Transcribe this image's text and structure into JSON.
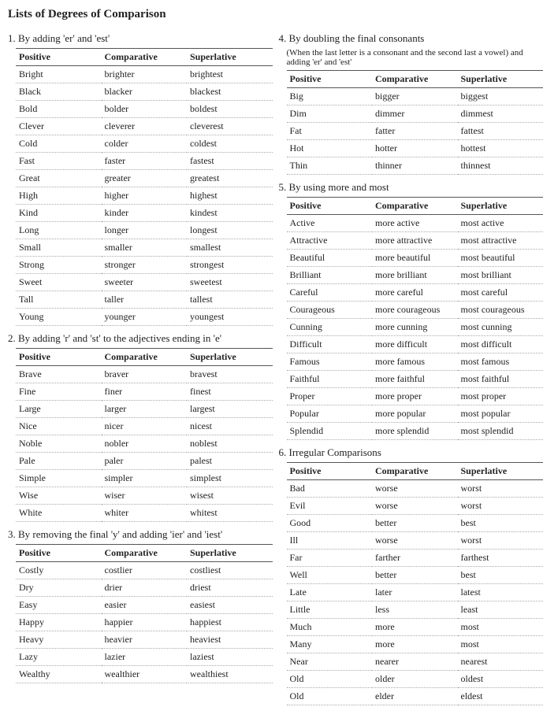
{
  "title": "Lists of Degrees of Comparison",
  "headers": {
    "positive": "Positive",
    "comparative": "Comparative",
    "superlative": "Superlative"
  },
  "sections": [
    {
      "title": "1. By adding 'er' and 'est'",
      "rows": [
        [
          "Bright",
          "brighter",
          "brightest"
        ],
        [
          "Black",
          "blacker",
          "blackest"
        ],
        [
          "Bold",
          "bolder",
          "boldest"
        ],
        [
          "Clever",
          "cleverer",
          "cleverest"
        ],
        [
          "Cold",
          "colder",
          "coldest"
        ],
        [
          "Fast",
          "faster",
          "fastest"
        ],
        [
          "Great",
          "greater",
          "greatest"
        ],
        [
          "High",
          "higher",
          "highest"
        ],
        [
          "Kind",
          "kinder",
          "kindest"
        ],
        [
          "Long",
          "longer",
          "longest"
        ],
        [
          "Small",
          "smaller",
          "smallest"
        ],
        [
          "Strong",
          "stronger",
          "strongest"
        ],
        [
          "Sweet",
          "sweeter",
          "sweetest"
        ],
        [
          "Tall",
          "taller",
          "tallest"
        ],
        [
          "Young",
          "younger",
          "youngest"
        ]
      ]
    },
    {
      "title": "2. By adding 'r' and 'st' to the adjectives ending in 'e'",
      "rows": [
        [
          "Brave",
          "braver",
          "bravest"
        ],
        [
          "Fine",
          "finer",
          "finest"
        ],
        [
          "Large",
          "larger",
          "largest"
        ],
        [
          "Nice",
          "nicer",
          "nicest"
        ],
        [
          "Noble",
          "nobler",
          "noblest"
        ],
        [
          "Pale",
          "paler",
          "palest"
        ],
        [
          "Simple",
          "simpler",
          "simplest"
        ],
        [
          "Wise",
          "wiser",
          "wisest"
        ],
        [
          "White",
          "whiter",
          "whitest"
        ]
      ]
    },
    {
      "title": "3. By removing the final 'y' and adding 'ier' and 'iest'",
      "rows": [
        [
          "Costly",
          "costlier",
          "costliest"
        ],
        [
          "Dry",
          "drier",
          "driest"
        ],
        [
          "Easy",
          "easier",
          "easiest"
        ],
        [
          "Happy",
          "happier",
          "happiest"
        ],
        [
          "Heavy",
          "heavier",
          "heaviest"
        ],
        [
          "Lazy",
          "lazier",
          "laziest"
        ],
        [
          "Wealthy",
          "wealthier",
          "wealthiest"
        ]
      ]
    },
    {
      "title": "4. By doubling the final consonants",
      "subnote": "(When the last letter is a consonant and the second last a vowel) and adding 'er' and 'est'",
      "rows": [
        [
          "Big",
          "bigger",
          "biggest"
        ],
        [
          "Dim",
          "dimmer",
          "dimmest"
        ],
        [
          "Fat",
          "fatter",
          "fattest"
        ],
        [
          "Hot",
          "hotter",
          "hottest"
        ],
        [
          "Thin",
          "thinner",
          "thinnest"
        ]
      ]
    },
    {
      "title": "5. By using more and most",
      "rows": [
        [
          "Active",
          "more active",
          "most active"
        ],
        [
          "Attractive",
          "more attractive",
          "most attractive"
        ],
        [
          "Beautiful",
          "more beautiful",
          "most beautiful"
        ],
        [
          "Brilliant",
          "more brilliant",
          "most brilliant"
        ],
        [
          "Careful",
          "more careful",
          "most careful"
        ],
        [
          "Courageous",
          "more courageous",
          "most courageous"
        ],
        [
          "Cunning",
          "more cunning",
          "most cunning"
        ],
        [
          "Difficult",
          "more difficult",
          "most difficult"
        ],
        [
          "Famous",
          "more famous",
          "most famous"
        ],
        [
          "Faithful",
          "more faithful",
          "most faithful"
        ],
        [
          "Proper",
          "more proper",
          "most proper"
        ],
        [
          "Popular",
          "more popular",
          "most popular"
        ],
        [
          "Splendid",
          "more splendid",
          "most splendid"
        ]
      ]
    },
    {
      "title": "6. Irregular Comparisons",
      "rows": [
        [
          "Bad",
          "worse",
          "worst"
        ],
        [
          "Evil",
          "worse",
          "worst"
        ],
        [
          "Good",
          "better",
          "best"
        ],
        [
          "Ill",
          "worse",
          "worst"
        ],
        [
          "Far",
          "farther",
          "farthest"
        ],
        [
          "Well",
          "better",
          "best"
        ],
        [
          "Late",
          "later",
          "latest"
        ],
        [
          "Little",
          "less",
          "least"
        ],
        [
          "Much",
          "more",
          "most"
        ],
        [
          "Many",
          "more",
          "most"
        ],
        [
          "Near",
          "nearer",
          "nearest"
        ],
        [
          "Old",
          "older",
          "oldest"
        ],
        [
          "Old",
          "elder",
          "eldest"
        ]
      ]
    }
  ]
}
